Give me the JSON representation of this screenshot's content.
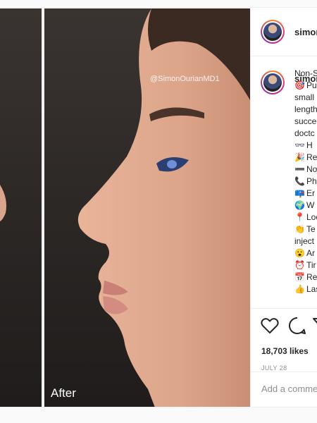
{
  "photo": {
    "watermark": "@SimonOurianMD1",
    "label": "After"
  },
  "post": {
    "username_header": "simon",
    "username_caption": "simor",
    "caption_lines": [
      {
        "emoji": "",
        "text": "Non-S"
      },
      {
        "emoji": "🎯",
        "text": "Pu"
      },
      {
        "emoji": "",
        "text": "small"
      },
      {
        "emoji": "",
        "text": "length"
      },
      {
        "emoji": "",
        "text": "succe"
      },
      {
        "emoji": "",
        "text": "doctc"
      },
      {
        "emoji": "👓",
        "text": "H"
      },
      {
        "emoji": "🎉",
        "text": "Re"
      },
      {
        "emoji": "➖",
        "text": "No"
      },
      {
        "emoji": "📞",
        "text": "Ph"
      },
      {
        "emoji": "📪",
        "text": "Er"
      },
      {
        "emoji": "🌍",
        "text": "W"
      },
      {
        "emoji": "📍",
        "text": "Loc"
      },
      {
        "emoji": "👏",
        "text": "Te"
      },
      {
        "emoji": "",
        "text": "inject"
      },
      {
        "emoji": "😮",
        "text": "Ar"
      },
      {
        "emoji": "⏰",
        "text": "Tir"
      },
      {
        "emoji": "📅",
        "text": "Re"
      },
      {
        "emoji": "👍",
        "text": "Las"
      }
    ],
    "likes": "18,703 likes",
    "date": "JULY 28",
    "comment_placeholder": "Add a comment"
  },
  "icons": {
    "like": "heart-icon",
    "comment": "comment-icon",
    "share": "share-icon"
  },
  "colors": {
    "text": "#262626",
    "muted": "#8e8e8e",
    "border": "#efefef",
    "story_ring": "#dd2a7b"
  }
}
